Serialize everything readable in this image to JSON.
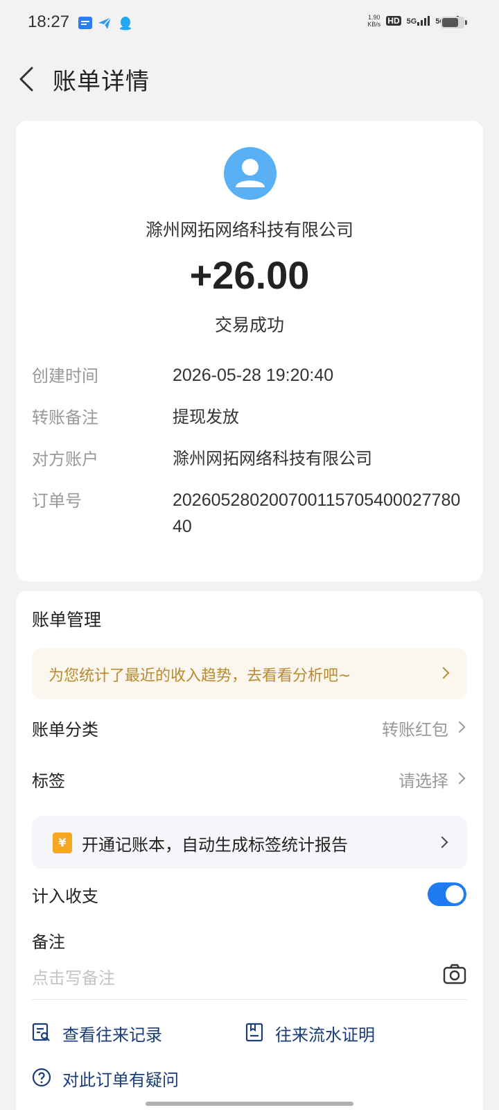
{
  "status_bar": {
    "time": "18:27",
    "speed_value": "1.90",
    "speed_unit": "KB/s",
    "hd_label": "HD",
    "net1_label": "5G",
    "net2_label": "5G",
    "battery_level": 0.75
  },
  "header": {
    "title": "账单详情"
  },
  "summary": {
    "merchant": "滁州网拓网络科技有限公司",
    "amount": "+26.00",
    "status": "交易成功",
    "avatar_color": "#5ab0f5"
  },
  "details": {
    "created_label": "创建时间",
    "created_value": "2026-05-28 19:20:40",
    "remark_label": "转账备注",
    "remark_value": "提现发放",
    "counterparty_label": "对方账户",
    "counterparty_value": "滁州网拓网络科技有限公司",
    "order_label": "订单号",
    "order_value": "202605280200700115705400027780 40"
  },
  "management": {
    "title": "账单管理",
    "tip": "为您统计了最近的收入趋势，去看看分析吧~",
    "category_label": "账单分类",
    "category_value": "转账红包",
    "tag_label": "标签",
    "tag_value": "请选择",
    "ledger_icon": "¥",
    "ledger_text": "开通记账本，自动生成标签统计报告",
    "include_label": "计入收支",
    "include_on": true,
    "memo_label": "备注",
    "memo_placeholder": "点击写备注"
  },
  "links": {
    "history": "查看往来记录",
    "proof": "往来流水证明",
    "question": "对此订单有疑问"
  },
  "colors": {
    "accent": "#1f7bf0",
    "tip_text": "#b98a2e",
    "link": "#1a3d7a"
  }
}
